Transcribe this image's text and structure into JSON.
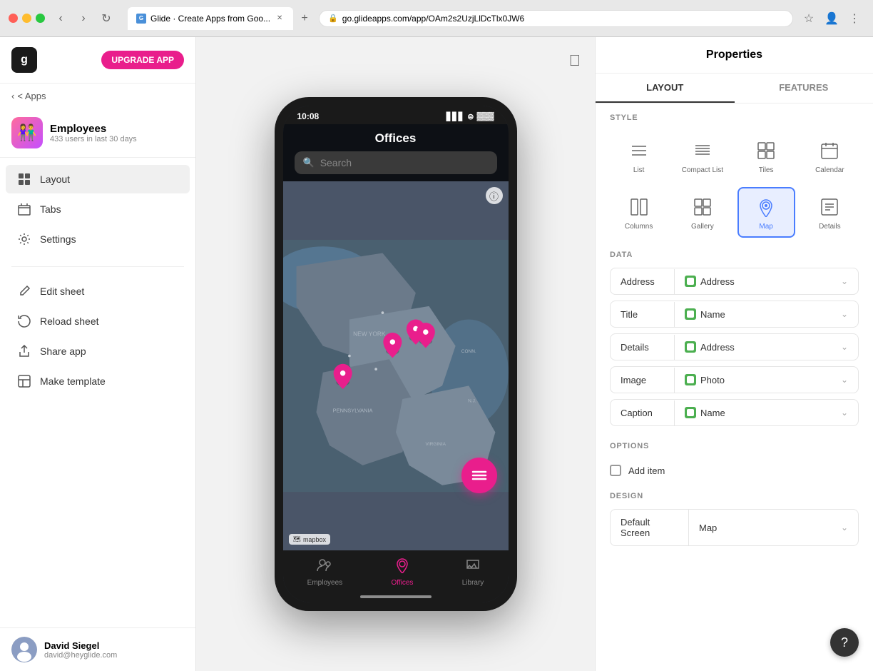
{
  "browser": {
    "url": "go.glideapps.com/app/OAm2s2UzjLlDcTlx0JW6",
    "tab_title": "Glide · Create Apps from Goo...",
    "new_tab_label": "+"
  },
  "sidebar": {
    "logo_text": "g",
    "upgrade_label": "UPGRADE APP",
    "back_label": "< Apps",
    "app": {
      "name": "Employees",
      "stats": "433 users in last 30 days",
      "emoji": "👫"
    },
    "nav_items": [
      {
        "id": "layout",
        "label": "Layout",
        "active": true
      },
      {
        "id": "tabs",
        "label": "Tabs",
        "active": false
      },
      {
        "id": "settings",
        "label": "Settings",
        "active": false
      }
    ],
    "action_items": [
      {
        "id": "edit-sheet",
        "label": "Edit sheet"
      },
      {
        "id": "reload-sheet",
        "label": "Reload sheet"
      },
      {
        "id": "share-app",
        "label": "Share app"
      },
      {
        "id": "make-template",
        "label": "Make template"
      }
    ],
    "user": {
      "name": "David Siegel",
      "email": "david@heyglide.com"
    }
  },
  "phone": {
    "time": "10:08",
    "screen_title": "Offices",
    "search_placeholder": "Search",
    "mapbox_label": "mapbox",
    "bottom_nav": [
      {
        "id": "employees",
        "label": "Employees",
        "active": false
      },
      {
        "id": "offices",
        "label": "Offices",
        "active": true
      },
      {
        "id": "library",
        "label": "Library",
        "active": false
      }
    ]
  },
  "properties": {
    "title": "Properties",
    "tabs": [
      {
        "id": "layout",
        "label": "LAYOUT",
        "active": true
      },
      {
        "id": "features",
        "label": "FEATURES",
        "active": false
      }
    ],
    "style": {
      "label": "STYLE",
      "options": [
        {
          "id": "list",
          "label": "List",
          "active": false
        },
        {
          "id": "compact-list",
          "label": "Compact List",
          "active": false
        },
        {
          "id": "tiles",
          "label": "Tiles",
          "active": false
        },
        {
          "id": "calendar",
          "label": "Calendar",
          "active": false
        },
        {
          "id": "columns",
          "label": "Columns",
          "active": false
        },
        {
          "id": "gallery",
          "label": "Gallery",
          "active": false
        },
        {
          "id": "map",
          "label": "Map",
          "active": true
        },
        {
          "id": "details",
          "label": "Details",
          "active": false
        }
      ]
    },
    "data": {
      "label": "DATA",
      "rows": [
        {
          "id": "address",
          "label": "Address",
          "value": "Address",
          "badge": "⬛"
        },
        {
          "id": "title",
          "label": "Title",
          "value": "Name",
          "badge": "⬛"
        },
        {
          "id": "details",
          "label": "Details",
          "value": "Address",
          "badge": "⬛"
        },
        {
          "id": "image",
          "label": "Image",
          "value": "Photo",
          "badge": "⬛"
        },
        {
          "id": "caption",
          "label": "Caption",
          "value": "Name",
          "badge": "⬛"
        }
      ]
    },
    "options": {
      "label": "OPTIONS",
      "add_item_label": "Add item"
    },
    "design": {
      "label": "DESIGN",
      "rows": [
        {
          "id": "default-screen",
          "label": "Default Screen",
          "value": "Map"
        }
      ]
    }
  }
}
